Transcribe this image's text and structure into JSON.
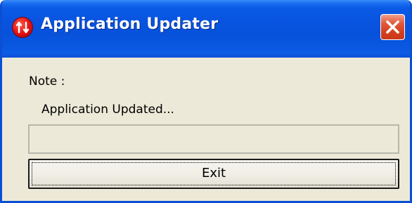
{
  "window": {
    "title": "Application Updater",
    "app_icon": "updater-arrows-icon",
    "close_icon": "close-icon"
  },
  "content": {
    "note_label": "Note :",
    "status_text": "Application Updated...",
    "progress": 0
  },
  "buttons": {
    "exit_label": "Exit"
  },
  "colors": {
    "titlebar": "#0853e0",
    "window_bg": "#ece9d8",
    "close_button": "#d4401e",
    "app_icon": "#e01010"
  }
}
